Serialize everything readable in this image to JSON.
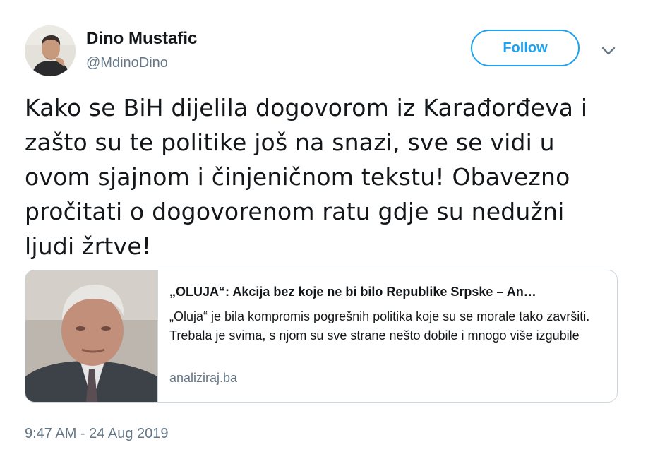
{
  "author": {
    "display_name": "Dino Mustafic",
    "handle": "@MdinoDino"
  },
  "follow_button": {
    "label": "Follow"
  },
  "menu": {
    "icon": "chevron-down-icon"
  },
  "tweet": {
    "text": "Kako se BiH dijelila dogovorom iz Karađorđeva i zašto su te politike još na snazi, sve se vidi u ovom sjajnom i činjeničnom tekstu! Obavezno pročitati o dogovorenom ratu gdje su nedužni ljudi žrtve!",
    "timestamp": "9:47 AM - 24 Aug 2019"
  },
  "card": {
    "title": "„OLUJA“: Akcija bez koje ne bi bilo Republike Srpske – An…",
    "description": "„Oluja“ je bila kompromis pogrešnih politika koje su se morale tako završiti. Trebala je svima, s njom su sve strane nešto dobile i mnogo više izgubile",
    "domain": "analiziraj.ba"
  },
  "colors": {
    "accent": "#1da1f2",
    "secondary_text": "#657786",
    "primary_text": "#14171a",
    "border": "#ccd6dd"
  }
}
